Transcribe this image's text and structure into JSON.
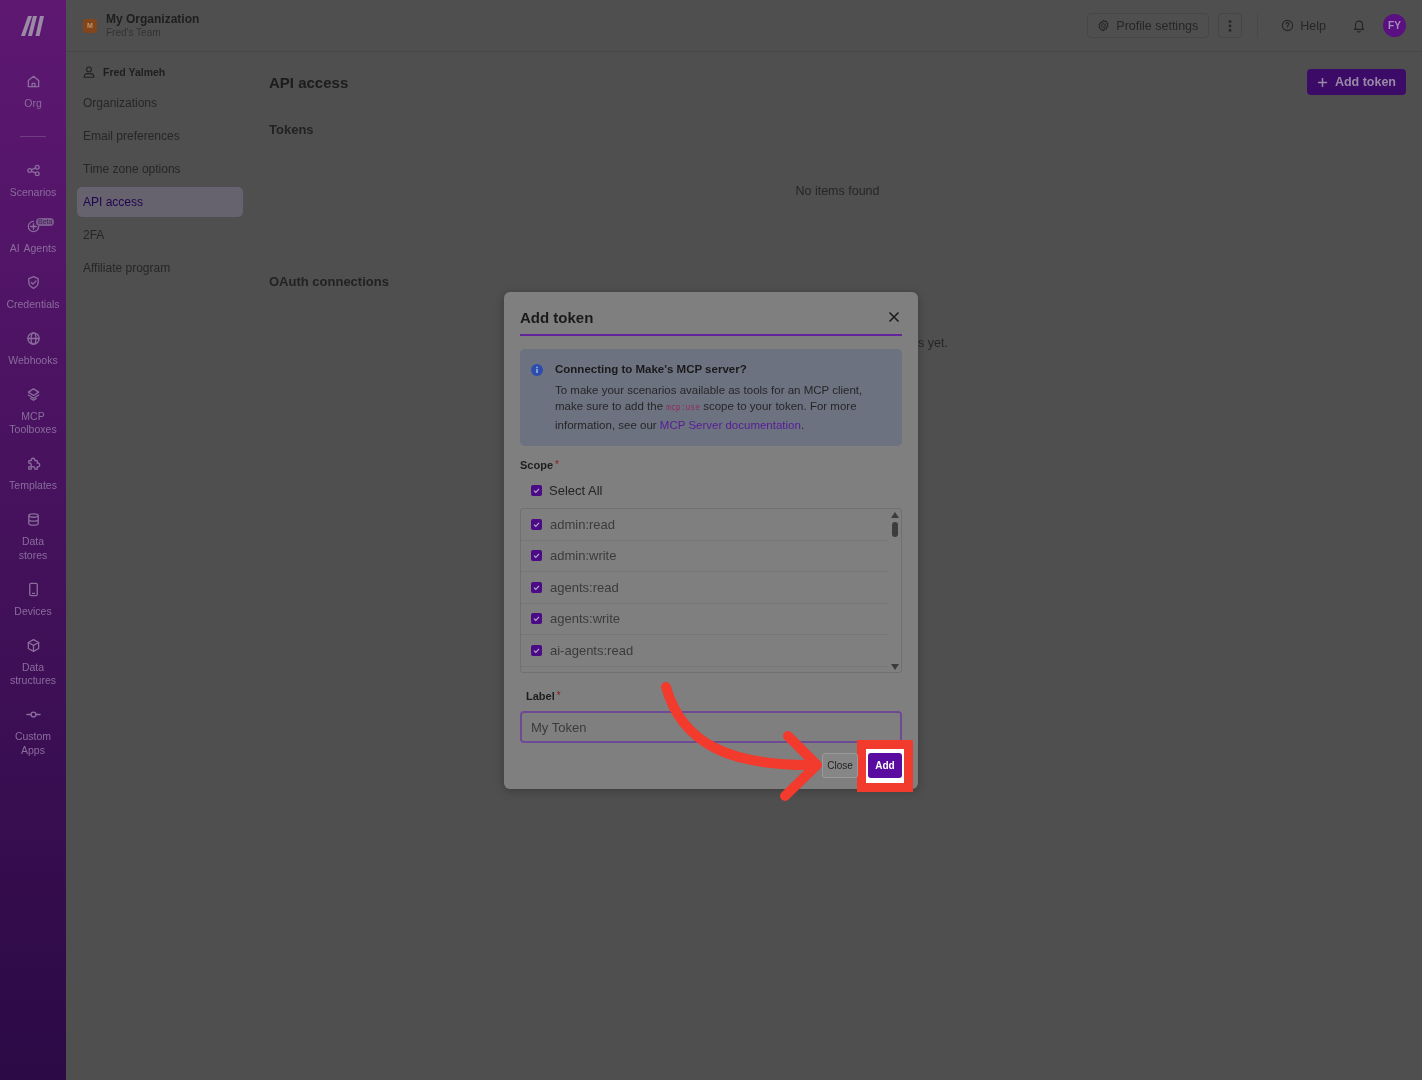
{
  "rail": {
    "home": {
      "label": "Org"
    },
    "items": [
      {
        "label": "Scenarios"
      },
      {
        "label": "AI Agents",
        "badge": "Beta"
      },
      {
        "label": "Credentials"
      },
      {
        "label": "Webhooks"
      },
      {
        "label": "MCP Toolboxes"
      },
      {
        "label": "Templates"
      },
      {
        "label": "Data stores"
      },
      {
        "label": "Devices"
      },
      {
        "label": "Data structures"
      },
      {
        "label": "Custom Apps"
      }
    ]
  },
  "header": {
    "org": {
      "initial": "M",
      "name": "My Organization",
      "team": "Fred's Team"
    },
    "profile_settings": "Profile settings",
    "help": "Help",
    "avatar": "FY"
  },
  "settings_nav": {
    "user": "Fred Yalmeh",
    "items": [
      {
        "label": "Organizations",
        "selected": false
      },
      {
        "label": "Email preferences",
        "selected": false
      },
      {
        "label": "Time zone options",
        "selected": false
      },
      {
        "label": "API access",
        "selected": true
      },
      {
        "label": "2FA",
        "selected": false
      },
      {
        "label": "Affiliate program",
        "selected": false
      }
    ]
  },
  "page": {
    "title": "API access",
    "add_button": "Add token",
    "tokens": {
      "heading": "Tokens",
      "empty_text": "No items found"
    },
    "oauth": {
      "heading": "OAuth connections",
      "empty_text": "s yet."
    }
  },
  "modal": {
    "title": "Add token",
    "info": {
      "title": "Connecting to Make's MCP server?",
      "text_before": "To make your scenarios available as tools for an MCP client, make sure to add the ",
      "code": "mcp:use",
      "text_middle": " scope to your token. For more information, see our ",
      "link": "MCP Server documentation",
      "text_after": "."
    },
    "scope": {
      "label": "Scope",
      "required_mark": "*",
      "select_all": {
        "label": "Select All",
        "checked": true
      },
      "options": [
        {
          "label": "admin:read",
          "checked": true
        },
        {
          "label": "admin:write",
          "checked": true
        },
        {
          "label": "agents:read",
          "checked": true
        },
        {
          "label": "agents:write",
          "checked": true
        },
        {
          "label": "ai-agents:read",
          "checked": true
        }
      ]
    },
    "label_field": {
      "label": "Label",
      "required_mark": "*",
      "value": "My Token"
    },
    "buttons": [
      {
        "label": "Close",
        "kind": "secondary",
        "highlighted": false
      },
      {
        "label": "Add",
        "kind": "primary",
        "highlighted": true
      }
    ]
  }
}
